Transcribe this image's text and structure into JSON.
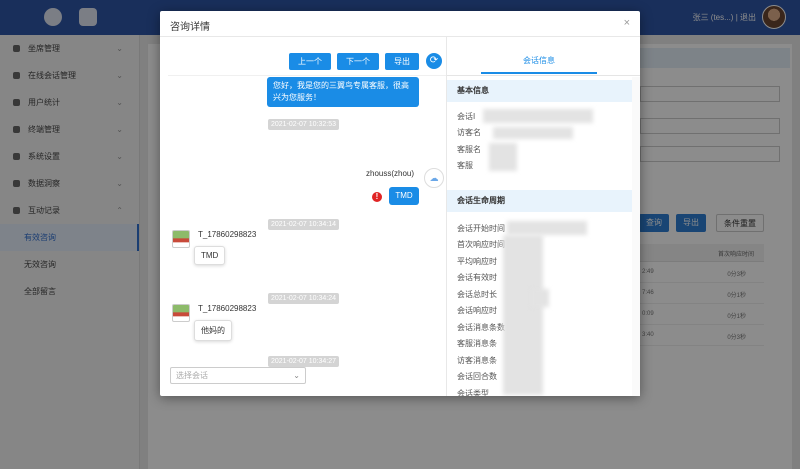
{
  "app": {
    "user": "张三 (tes...) | 退出",
    "sidebar": [
      {
        "label": "坐席管理",
        "sub": false,
        "active": false
      },
      {
        "label": "在线会话管理",
        "sub": false,
        "active": false
      },
      {
        "label": "用户统计",
        "sub": false,
        "active": false
      },
      {
        "label": "终端管理",
        "sub": false,
        "active": false
      },
      {
        "label": "系统设置",
        "sub": false,
        "active": false
      },
      {
        "label": "数据洞察",
        "sub": false,
        "active": false
      },
      {
        "label": "互动记录",
        "sub": false,
        "active": false
      },
      {
        "label": "有效咨询",
        "sub": true,
        "active": true
      },
      {
        "label": "无效咨询",
        "sub": true,
        "active": false
      },
      {
        "label": "全部留言",
        "sub": true,
        "active": false
      }
    ],
    "buttons": {
      "query": "查询",
      "export": "导出",
      "reset": "条件重置"
    },
    "table": {
      "header": "首次响应时间",
      "rows": [
        {
          "time": "2:49",
          "value": "0分3秒"
        },
        {
          "time": "7:46",
          "value": "0分1秒"
        },
        {
          "time": "0:09",
          "value": "0分1秒"
        },
        {
          "time": "3:40",
          "value": "0分3秒"
        }
      ]
    }
  },
  "modal": {
    "title": "咨询详情",
    "close": "×",
    "toolbar": {
      "prev": "上一个",
      "next": "下一个",
      "export": "导出",
      "refresh": "⟳"
    },
    "messages": {
      "greeting": "您好，我是您的三翼鸟专属客服，很高兴为您服务！",
      "ts1": "2021-02-07 10:32:53",
      "agent_name": "zhouss(zhou)",
      "agent_msg": "TMD",
      "warn": "!",
      "ts2": "2021-02-07 10:34:14",
      "cust1_name": "T_17860298823",
      "cust1_msg": "TMD",
      "ts3": "2021-02-07 10:34:24",
      "cust2_name": "T_17860298823",
      "cust2_msg": "他妈的",
      "ts4": "2021-02-07 10:34:27"
    },
    "select_placeholder": "选择会话",
    "info": {
      "tab": "会话信息",
      "basic_title": "基本信息",
      "basic_fields": [
        "会话I",
        "访客名",
        "客服名",
        "客服"
      ],
      "life_title": "会话生命周期",
      "life_fields": [
        "会话开始时间",
        "首次响应时间",
        "平均响应时",
        "会话有效时",
        "会话总时长",
        "会话响应时",
        "会话消息条数",
        "客服消息条",
        "访客消息条",
        "会话回合数",
        "会话类型"
      ]
    }
  }
}
